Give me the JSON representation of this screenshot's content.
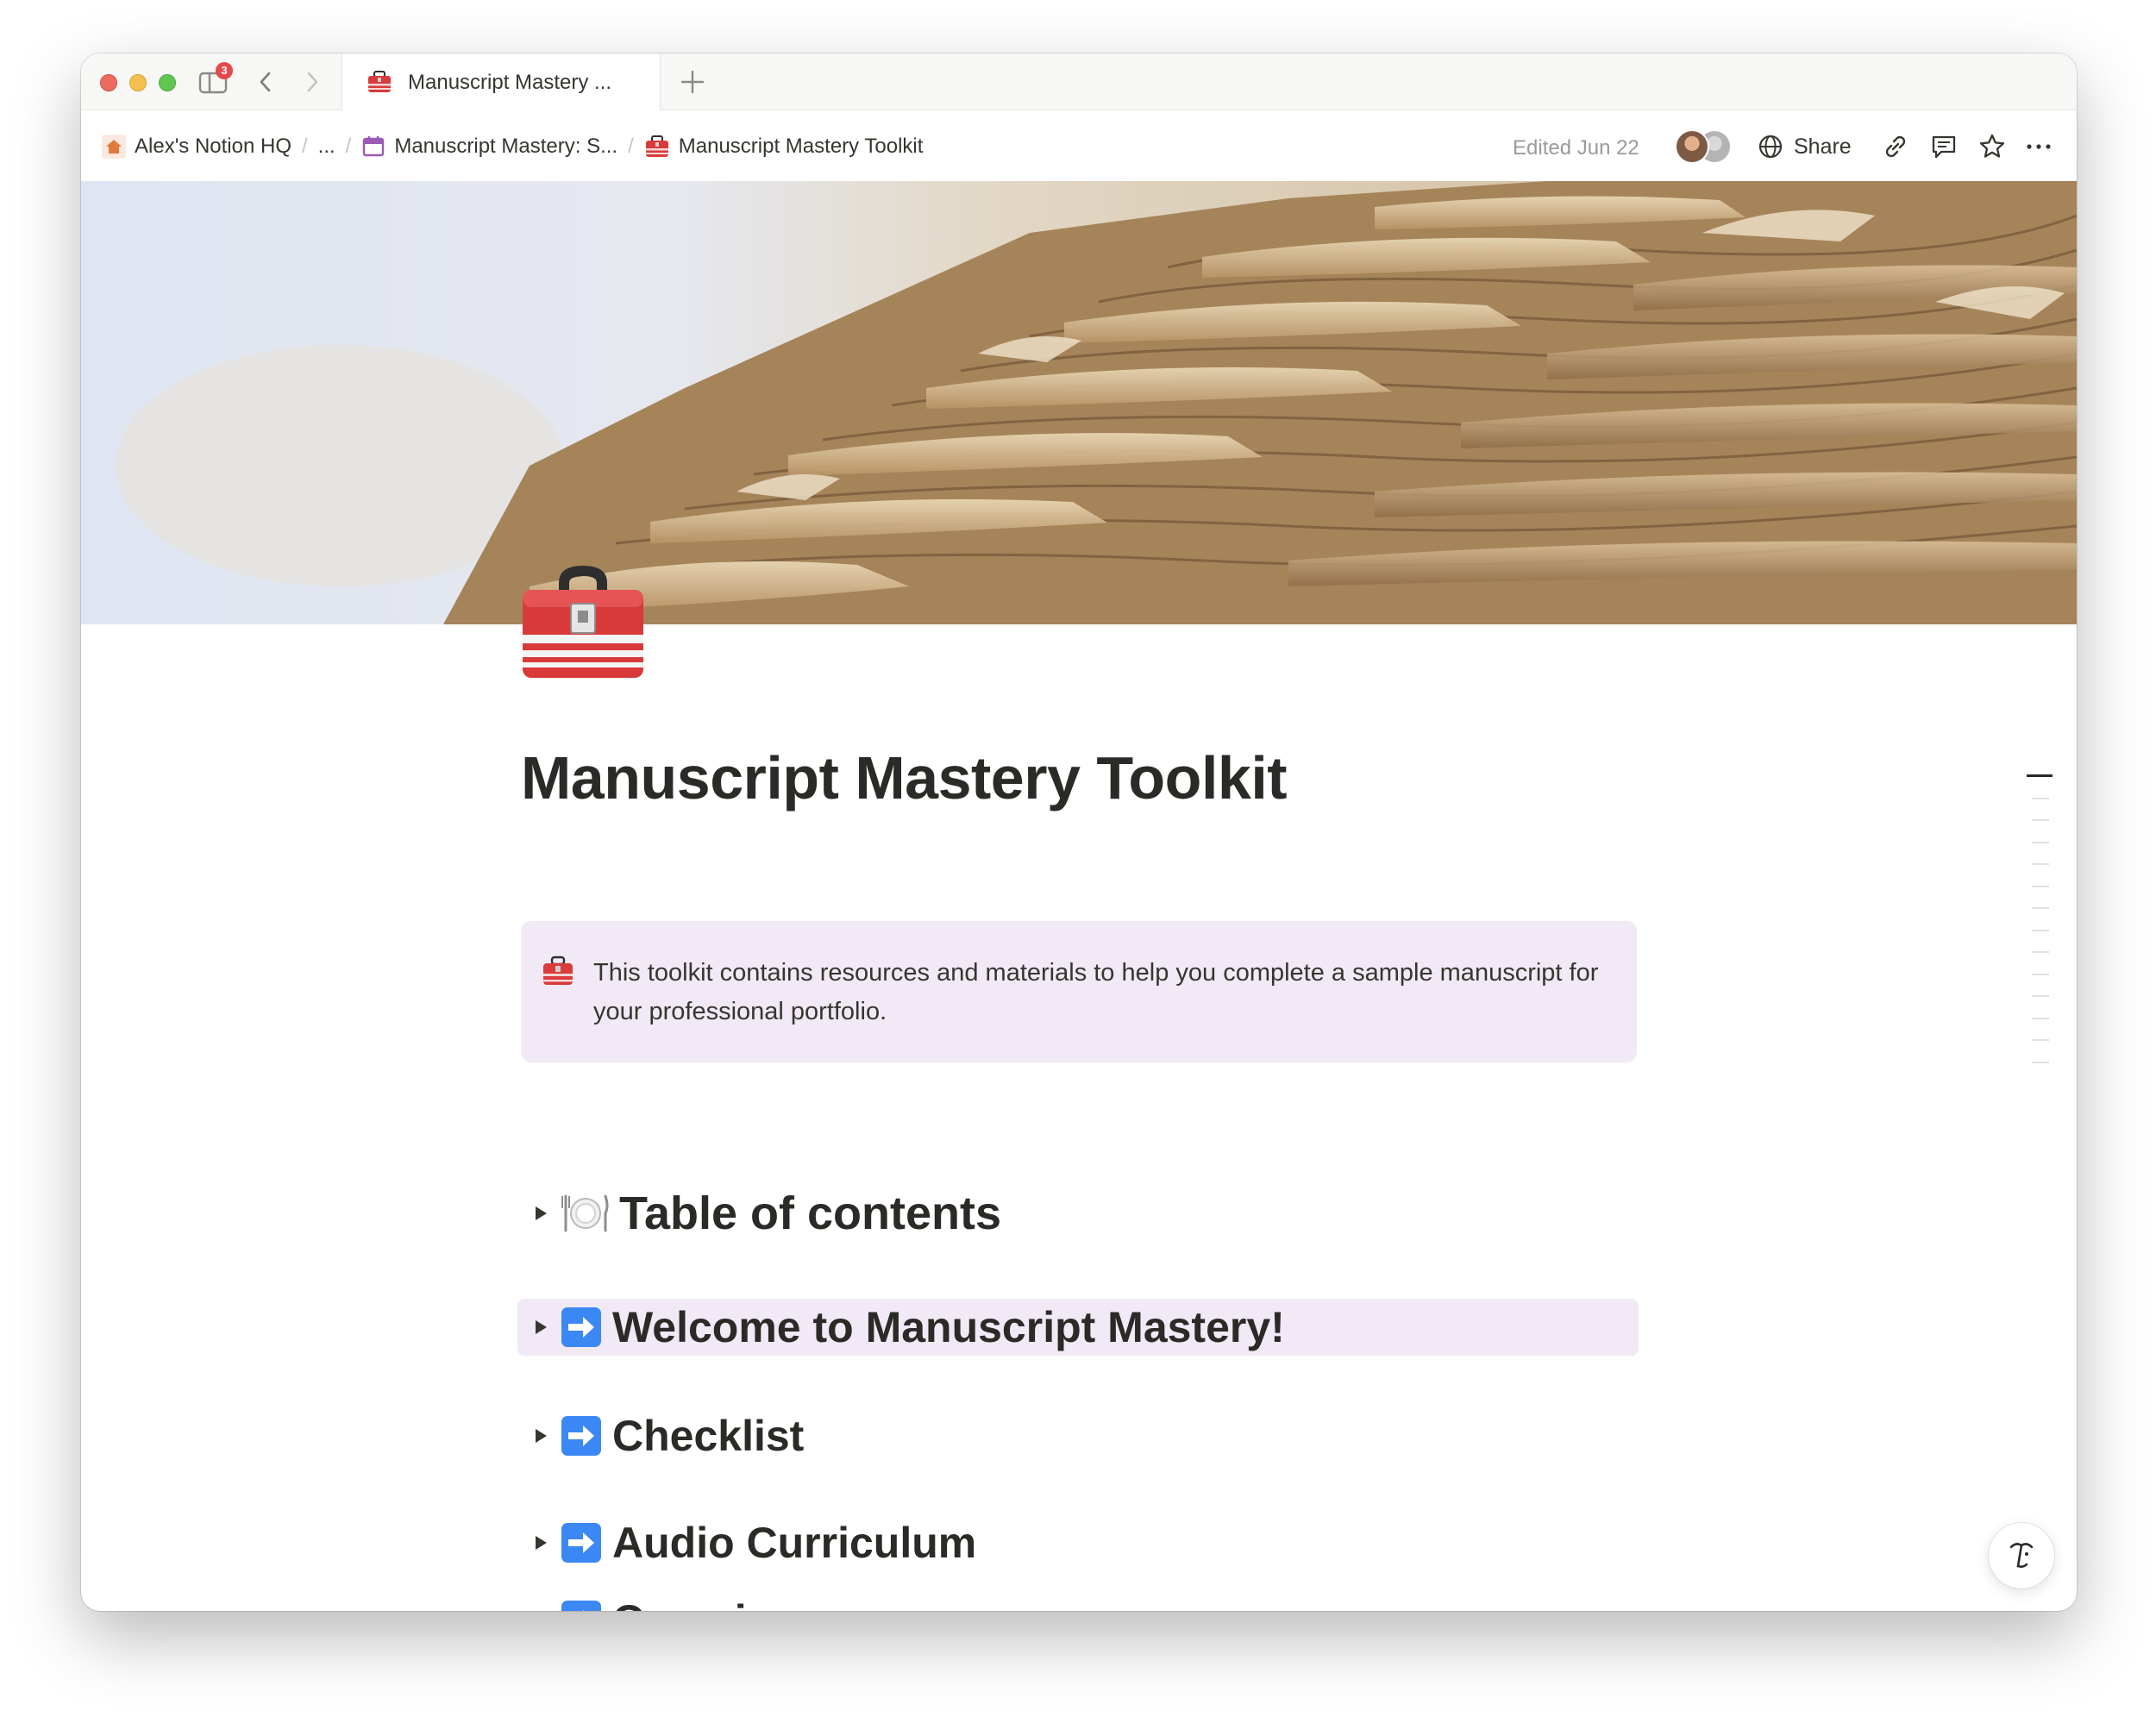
{
  "tab": {
    "title": "Manuscript Mastery ...",
    "icon": "toolbox-icon",
    "notification_count": "3"
  },
  "breadcrumbs": [
    {
      "label": "Alex's Notion HQ",
      "icon": "house-icon"
    },
    {
      "label": "..."
    },
    {
      "label": "Manuscript Mastery: S...",
      "icon": "calendar-icon"
    },
    {
      "label": "Manuscript Mastery Toolkit",
      "icon": "toolbox-icon"
    }
  ],
  "topbar": {
    "edited": "Edited Jun 22",
    "share_label": "Share"
  },
  "page": {
    "title": "Manuscript Mastery Toolkit",
    "icon": "toolbox-icon",
    "callout": {
      "icon": "toolbox-icon",
      "text": "This toolkit contains resources and materials to help you complete a sample manuscript for your professional portfolio.",
      "background": "#f1e9f6"
    },
    "toggles": [
      {
        "icon": "plate-icon",
        "label": "Table of contents",
        "highlighted": false
      },
      {
        "icon": "arrow-right-icon",
        "label": "Welcome to Manuscript Mastery!",
        "highlighted": true
      },
      {
        "icon": "arrow-right-icon",
        "label": "Checklist",
        "highlighted": false
      },
      {
        "icon": "arrow-right-icon",
        "label": "Audio Curriculum",
        "highlighted": false
      },
      {
        "icon": "arrow-right-icon",
        "label": "Overview",
        "highlighted": false
      }
    ]
  },
  "colors": {
    "accent_highlight": "#f1e9f6",
    "text": "#37352f",
    "muted": "#9b9a97"
  }
}
